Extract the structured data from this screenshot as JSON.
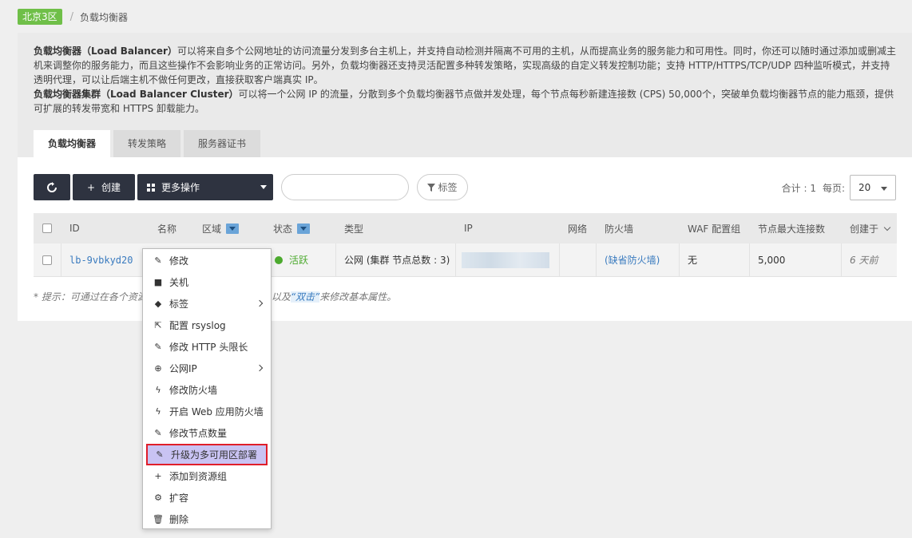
{
  "breadcrumb": {
    "region": "北京3区",
    "separator": "/",
    "current": "负载均衡器"
  },
  "intro": {
    "p1_bold": "负载均衡器（Load Balancer）",
    "p1_text": "可以将来自多个公网地址的访问流量分发到多台主机上，并支持自动检测并隔离不可用的主机，从而提高业务的服务能力和可用性。同时，你还可以随时通过添加或删减主机来调整你的服务能力，而且这些操作不会影响业务的正常访问。另外，负载均衡器还支持灵活配置多种转发策略，实现高级的自定义转发控制功能；支持 HTTP/HTTPS/TCP/UDP 四种监听模式，并支持透明代理，可以让后端主机不做任何更改，直接获取客户端真实 IP。",
    "p2_bold": "负载均衡器集群（Load Balancer Cluster）",
    "p2_text": "可以将一个公网 IP 的流量，分散到多个负载均衡器节点做并发处理，每个节点每秒新建连接数 (CPS) 50,000个，突破单负载均衡器节点的能力瓶颈，提供可扩展的转发带宽和 HTTPS 卸载能力。"
  },
  "tabs": [
    {
      "label": "负载均衡器",
      "active": true
    },
    {
      "label": "转发策略",
      "active": false
    },
    {
      "label": "服务器证书",
      "active": false
    }
  ],
  "toolbar": {
    "create_label": "创建",
    "more_label": "更多操作",
    "search_placeholder": "",
    "tag_label": "标签",
    "total_label": "合计 : 1",
    "per_page_label": "每页:",
    "per_page_value": "20"
  },
  "table": {
    "columns": [
      "ID",
      "名称",
      "区域",
      "状态",
      "类型",
      "IP",
      "网络",
      "防火墙",
      "WAF 配置组",
      "节点最大连接数",
      "创建于"
    ],
    "row": {
      "id": "lb-9vbkyd20",
      "status": "活跃",
      "type": "公网 (集群 节点总数 : 3)",
      "firewall": "(缺省防火墙)",
      "waf": "无",
      "max_conn": "5,000",
      "created": "6 天前"
    }
  },
  "hint": {
    "prefix": "* 提示：可通过在各个资源",
    "middle": "以及",
    "highlight": "“双击”",
    "suffix": "来修改基本属性。"
  },
  "context_menu": [
    {
      "label": "修改",
      "icon": "pencil-icon",
      "glyph": "✎"
    },
    {
      "label": "关机",
      "icon": "stop-icon",
      "glyph": "■"
    },
    {
      "label": "标签",
      "icon": "tag-icon",
      "glyph": "◆",
      "submenu": true
    },
    {
      "label": "配置 rsyslog",
      "icon": "share-icon",
      "glyph": "⇱"
    },
    {
      "label": "修改 HTTP 头限长",
      "icon": "pencil-icon",
      "glyph": "✎"
    },
    {
      "label": "公网IP",
      "icon": "globe-icon",
      "glyph": "⊕",
      "submenu": true
    },
    {
      "label": "修改防火墙",
      "icon": "bolt-icon",
      "glyph": "ϟ"
    },
    {
      "label": "开启 Web 应用防火墙",
      "icon": "bolt-icon",
      "glyph": "ϟ"
    },
    {
      "label": "修改节点数量",
      "icon": "pencil-icon",
      "glyph": "✎"
    },
    {
      "label": "升级为多可用区部署",
      "icon": "pencil-icon",
      "glyph": "✎",
      "highlight": true
    },
    {
      "label": "添加到资源组",
      "icon": "plus-icon",
      "glyph": "+"
    },
    {
      "label": "扩容",
      "icon": "gear-icon",
      "glyph": "⚙"
    },
    {
      "label": "删除",
      "icon": "trash-icon",
      "glyph": "🗑"
    }
  ]
}
